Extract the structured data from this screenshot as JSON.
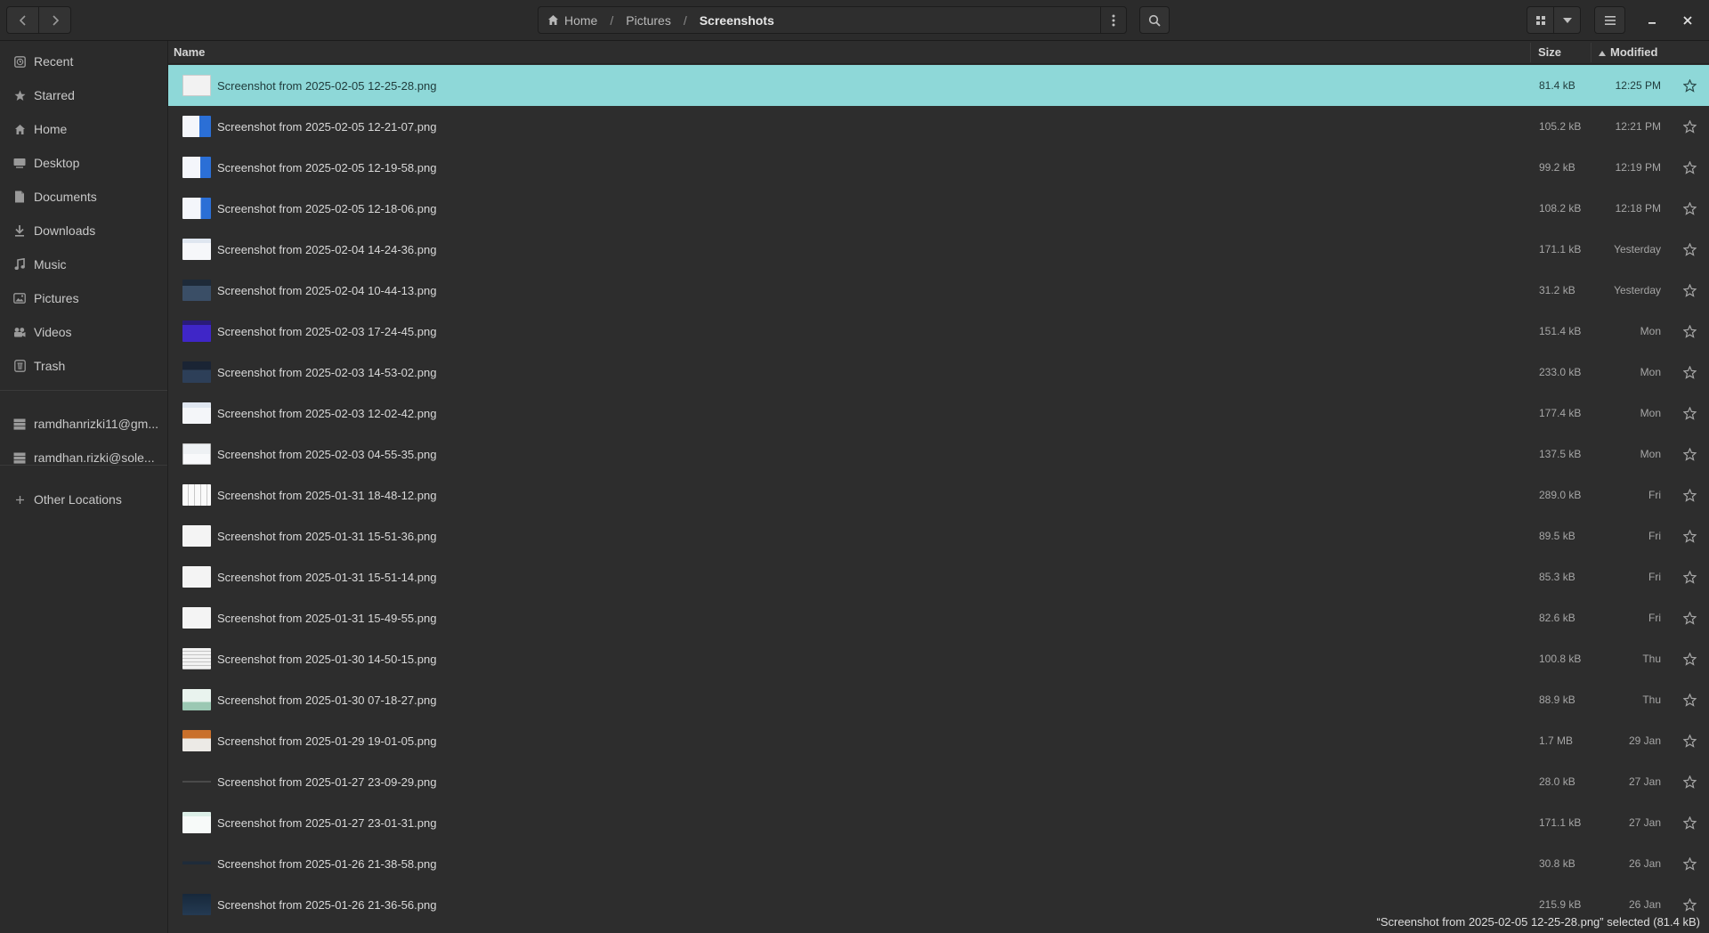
{
  "header": {
    "breadcrumbs": [
      "Home",
      "Pictures",
      "Screenshots"
    ],
    "icons": {
      "back": "chevron-left-icon",
      "forward": "chevron-right-icon",
      "path_menu": "vertical-dots-icon",
      "search": "search-icon",
      "grid_view": "grid-icon",
      "view_options": "chevron-down-icon",
      "main_menu": "hamburger-icon",
      "minimize": "minimize-icon",
      "close": "close-icon"
    }
  },
  "sidebar": {
    "items": [
      {
        "label": "Recent",
        "icon": "clock-icon"
      },
      {
        "label": "Starred",
        "icon": "star-icon"
      },
      {
        "label": "Home",
        "icon": "home-icon"
      },
      {
        "label": "Desktop",
        "icon": "desktop-icon"
      },
      {
        "label": "Documents",
        "icon": "document-icon"
      },
      {
        "label": "Downloads",
        "icon": "download-icon"
      },
      {
        "label": "Music",
        "icon": "music-icon"
      },
      {
        "label": "Pictures",
        "icon": "picture-icon"
      },
      {
        "label": "Videos",
        "icon": "video-icon"
      },
      {
        "label": "Trash",
        "icon": "trash-icon"
      }
    ],
    "accounts": [
      {
        "label": "ramdhanrizki11@gm...",
        "icon": "network-drive-icon"
      },
      {
        "label": "ramdhan.rizki@sole...",
        "icon": "network-drive-icon"
      }
    ],
    "other": {
      "label": "Other Locations",
      "icon": "plus-icon"
    }
  },
  "columns": {
    "name": "Name",
    "size": "Size",
    "modified": "Modified"
  },
  "files": [
    {
      "name": "Screenshot from 2025-02-05 12-25-28.png",
      "size": "81.4 kB",
      "modified": "12:25 PM"
    },
    {
      "name": "Screenshot from 2025-02-05 12-21-07.png",
      "size": "105.2 kB",
      "modified": "12:21 PM"
    },
    {
      "name": "Screenshot from 2025-02-05 12-19-58.png",
      "size": "99.2 kB",
      "modified": "12:19 PM"
    },
    {
      "name": "Screenshot from 2025-02-05 12-18-06.png",
      "size": "108.2 kB",
      "modified": "12:18 PM"
    },
    {
      "name": "Screenshot from 2025-02-04 14-24-36.png",
      "size": "171.1 kB",
      "modified": "Yesterday"
    },
    {
      "name": "Screenshot from 2025-02-04 10-44-13.png",
      "size": "31.2 kB",
      "modified": "Yesterday"
    },
    {
      "name": "Screenshot from 2025-02-03 17-24-45.png",
      "size": "151.4 kB",
      "modified": "Mon"
    },
    {
      "name": "Screenshot from 2025-02-03 14-53-02.png",
      "size": "233.0 kB",
      "modified": "Mon"
    },
    {
      "name": "Screenshot from 2025-02-03 12-02-42.png",
      "size": "177.4 kB",
      "modified": "Mon"
    },
    {
      "name": "Screenshot from 2025-02-03 04-55-35.png",
      "size": "137.5 kB",
      "modified": "Mon"
    },
    {
      "name": "Screenshot from 2025-01-31 18-48-12.png",
      "size": "289.0 kB",
      "modified": "Fri"
    },
    {
      "name": "Screenshot from 2025-01-31 15-51-36.png",
      "size": "89.5 kB",
      "modified": "Fri"
    },
    {
      "name": "Screenshot from 2025-01-31 15-51-14.png",
      "size": "85.3 kB",
      "modified": "Fri"
    },
    {
      "name": "Screenshot from 2025-01-31 15-49-55.png",
      "size": "82.6 kB",
      "modified": "Fri"
    },
    {
      "name": "Screenshot from 2025-01-30 14-50-15.png",
      "size": "100.8 kB",
      "modified": "Thu"
    },
    {
      "name": "Screenshot from 2025-01-30 07-18-27.png",
      "size": "88.9 kB",
      "modified": "Thu"
    },
    {
      "name": "Screenshot from 2025-01-29 19-01-05.png",
      "size": "1.7 MB",
      "modified": "29 Jan"
    },
    {
      "name": "Screenshot from 2025-01-27 23-09-29.png",
      "size": "28.0 kB",
      "modified": "27 Jan"
    },
    {
      "name": "Screenshot from 2025-01-27 23-01-31.png",
      "size": "171.1 kB",
      "modified": "27 Jan"
    },
    {
      "name": "Screenshot from 2025-01-26 21-38-58.png",
      "size": "30.8 kB",
      "modified": "26 Jan"
    },
    {
      "name": "Screenshot from 2025-01-26 21-36-56.png",
      "size": "215.9 kB",
      "modified": "26 Jan"
    }
  ],
  "status": "“Screenshot from 2025-02-05 12-25-28.png” selected  (81.4 kB)",
  "colors": {
    "selection": "#8ed8d8",
    "background": "#2d2d2d"
  }
}
